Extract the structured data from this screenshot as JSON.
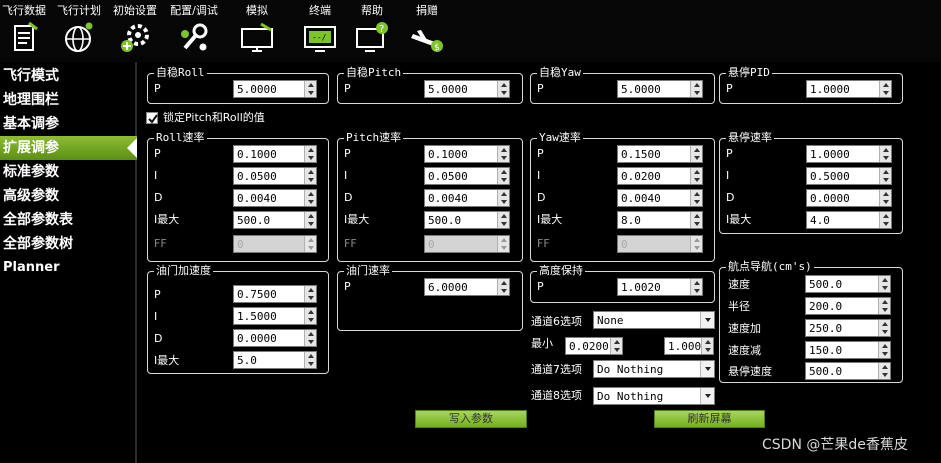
{
  "menu": [
    {
      "label": "飞行数据",
      "icon": "flight-data-icon"
    },
    {
      "label": "飞行计划",
      "icon": "flight-plan-icon"
    },
    {
      "label": "初始设置",
      "icon": "initial-setup-icon"
    },
    {
      "label": "配置/调试",
      "icon": "config-tuning-icon"
    },
    {
      "label": "模拟",
      "icon": "simulation-icon"
    },
    {
      "label": "终端",
      "icon": "terminal-icon"
    },
    {
      "label": "帮助",
      "icon": "help-icon"
    },
    {
      "label": "捐赠",
      "icon": "donate-icon"
    }
  ],
  "sidebar": {
    "items": [
      "飞行模式",
      "地理围栏",
      "基本调参",
      "扩展调参",
      "标准参数",
      "高级参数",
      "全部参数表",
      "全部参数树",
      "Planner"
    ],
    "active_index": 3
  },
  "stab_roll": {
    "title": "自稳Roll",
    "p_label": "P",
    "p": "5.0000"
  },
  "stab_pitch": {
    "title": "自稳Pitch",
    "p_label": "P",
    "p": "5.0000"
  },
  "stab_yaw": {
    "title": "自稳Yaw",
    "p_label": "P",
    "p": "5.0000"
  },
  "loiter_pid": {
    "title": "悬停PID",
    "p_label": "P",
    "p": "1.0000"
  },
  "lock_pitch_roll": {
    "label": "锁定Pitch和Roll的值",
    "checked": true
  },
  "rate_roll": {
    "title": "Roll速率",
    "labels": [
      "P",
      "I",
      "D",
      "I最大",
      "FF"
    ],
    "values": [
      "0.1000",
      "0.0500",
      "0.0040",
      "500.0",
      "0"
    ]
  },
  "rate_pitch": {
    "title": "Pitch速率",
    "labels": [
      "P",
      "I",
      "D",
      "I最大",
      "FF"
    ],
    "values": [
      "0.1000",
      "0.0500",
      "0.0040",
      "500.0",
      "0"
    ]
  },
  "rate_yaw": {
    "title": "Yaw速率",
    "labels": [
      "P",
      "I",
      "D",
      "I最大",
      "FF"
    ],
    "values": [
      "0.1500",
      "0.0200",
      "0.0040",
      "8.0",
      "0"
    ]
  },
  "loiter_rate": {
    "title": "悬停速率",
    "labels": [
      "P",
      "I",
      "D",
      "I最大"
    ],
    "values": [
      "1.0000",
      "0.5000",
      "0.0000",
      "4.0"
    ]
  },
  "throttle_accel": {
    "title": "油门加速度",
    "labels": [
      "P",
      "I",
      "D",
      "I最大"
    ],
    "values": [
      "0.7500",
      "1.5000",
      "0.0000",
      "5.0"
    ]
  },
  "throttle_rate": {
    "title": "油门速率",
    "p_label": "P",
    "p": "6.0000"
  },
  "alt_hold": {
    "title": "高度保持",
    "p_label": "P",
    "p": "1.0020"
  },
  "waypoint_nav": {
    "title": "航点导航(cm's)",
    "labels": [
      "速度",
      "半径",
      "速度加",
      "速度减",
      "悬停速度"
    ],
    "values": [
      "500.0",
      "200.0",
      "250.0",
      "150.0",
      "500.0"
    ]
  },
  "channels": {
    "ch6_label": "通道6选项",
    "ch6_value": "None",
    "min_label": "最小",
    "min_value": "0.0200",
    "max_value": "1.000",
    "ch7_label": "通道7选项",
    "ch7_value": "Do Nothing",
    "ch8_label": "通道8选项",
    "ch8_value": "Do Nothing"
  },
  "actions": {
    "write_label": "写入参数",
    "refresh_label": "刷新屏幕"
  },
  "watermark": "CSDN @芒果de香蕉皮",
  "colors": {
    "accent_green": "#8ebd34",
    "background": "#000000"
  }
}
